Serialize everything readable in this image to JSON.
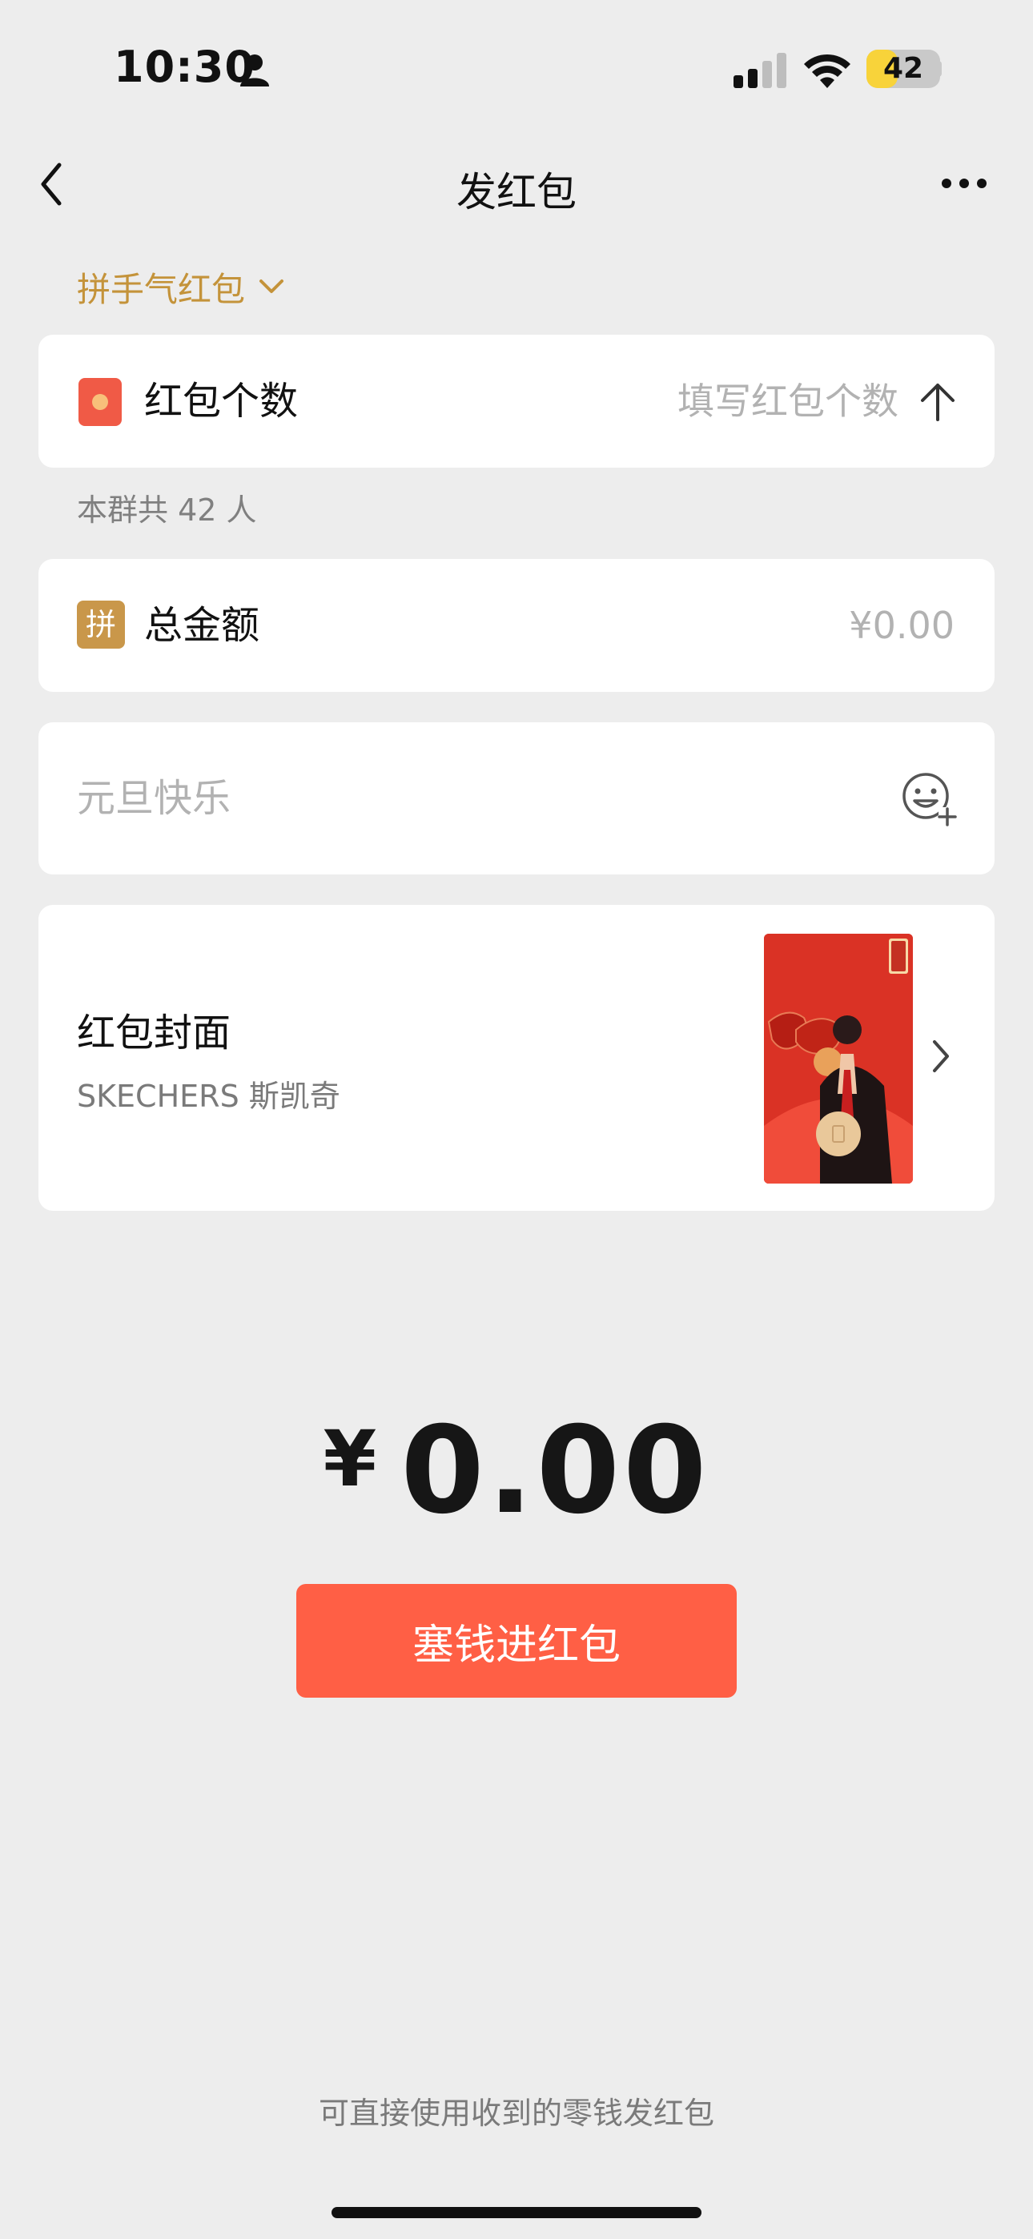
{
  "status_bar": {
    "time": "10:30",
    "battery": "42",
    "battery_fraction": 0.42,
    "icons": [
      "person-icon",
      "signal-icon",
      "wifi-icon",
      "battery-icon"
    ]
  },
  "nav": {
    "title": "发红包",
    "back_icon": "back-icon",
    "more_icon": "more-icon"
  },
  "packet_type": {
    "label": "拼手气红包"
  },
  "count_field": {
    "label": "红包个数",
    "placeholder": "填写红包个数",
    "icon": "redpack-icon"
  },
  "group_hint": "本群共 42 人",
  "amount_field": {
    "badge": "拼",
    "label": "总金额",
    "value": "¥0.00"
  },
  "greeting_field": {
    "placeholder": "元旦快乐",
    "icon": "emoji-add-icon"
  },
  "cover": {
    "label": "红包封面",
    "brand": "SKECHERS 斯凯奇"
  },
  "total": {
    "currency": "¥",
    "amount": "0.00"
  },
  "submit_label": "塞钱进红包",
  "footer_hint": "可直接使用收到的零钱发红包",
  "colors": {
    "accent": "#FF5F45",
    "gold": "#C4933A",
    "background": "#EDEDED"
  }
}
